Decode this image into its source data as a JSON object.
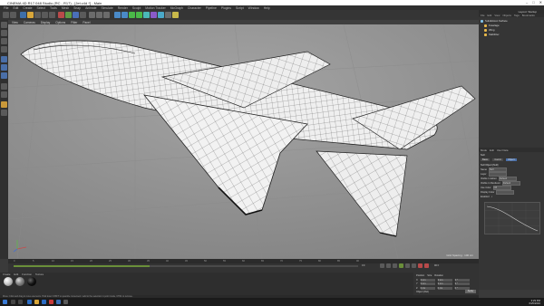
{
  "window": {
    "title": "CINEMA 4D R17.048 Studio (RC - R17) - [Jet.c4d *] - Main",
    "controls": [
      "–",
      "□",
      "✕"
    ]
  },
  "menubar": [
    "File",
    "Edit",
    "Create",
    "Select",
    "Tools",
    "Mesh",
    "Snap",
    "Animate",
    "Simulate",
    "Render",
    "Sculpt",
    "Motion Tracker",
    "MoGraph",
    "Character",
    "Pipeline",
    "Plugins",
    "Script",
    "Window",
    "Help"
  ],
  "toolbar": {
    "icons": [
      "undo-icon",
      "redo-icon",
      "live-selection-icon",
      "move-icon",
      "scale-icon",
      "rotate-icon",
      "recent-tools-icon",
      "x-axis-icon",
      "y-axis-icon",
      "z-axis-icon",
      "coordinate-system-icon",
      "render-view-icon",
      "render-picture-viewer-icon",
      "render-settings-icon",
      "cube-icon",
      "pen-icon",
      "subdivision-icon",
      "array-icon",
      "cloner-icon",
      "deformer-icon",
      "floor-icon",
      "camera-icon",
      "light-icon"
    ]
  },
  "viewport": {
    "menu": [
      "View",
      "Cameras",
      "Display",
      "Options",
      "Filter",
      "Panel"
    ],
    "info": "Grid Spacing : 100 cm"
  },
  "right_panel": {
    "layout_label": "Layout:",
    "layout_value": "Startup",
    "object_tabs": [
      "File",
      "Edit",
      "View",
      "Objects",
      "Tags",
      "Bookmarks"
    ],
    "objects": [
      {
        "name": "Subdivision Surface",
        "color": "#7fc1e8"
      },
      {
        "name": "Fuselage",
        "color": "#e8b84a"
      },
      {
        "name": "Wing",
        "color": "#e8b84a"
      },
      {
        "name": "Stabilizer",
        "color": "#e8b84a"
      }
    ],
    "attributes": {
      "tabs": [
        "Mode",
        "Edit",
        "User Data"
      ],
      "object_label": "Null",
      "subtabs": [
        "Basic",
        "Coord.",
        "Object"
      ],
      "section": "Null Object [Null]",
      "fields": [
        {
          "label": "Name",
          "value": "Null"
        },
        {
          "label": "Layer",
          "value": ""
        },
        {
          "label": "Visible in Editor",
          "value": "Default"
        },
        {
          "label": "Visible in Renderer",
          "value": "Default"
        },
        {
          "label": "Use Color",
          "value": "Off"
        },
        {
          "label": "Display Color",
          "value": ""
        },
        {
          "label": "Enabled",
          "value": "✓"
        }
      ]
    }
  },
  "timeline": {
    "frames": [
      "0",
      "5",
      "10",
      "15",
      "20",
      "25",
      "30",
      "35",
      "40",
      "45",
      "50",
      "55",
      "60",
      "65",
      "70",
      "75",
      "80",
      "85",
      "90"
    ],
    "current_frame": "0 F",
    "end_frame": "90 F"
  },
  "materials": {
    "menu": [
      "Create",
      "Edit",
      "Function",
      "Texture"
    ],
    "swatches": [
      "#cfcfcf",
      "#8a8a8a",
      "#111111"
    ]
  },
  "coordinates": {
    "headers": [
      "Position",
      "Size",
      "Rotation"
    ],
    "rows": [
      {
        "axis": "X",
        "p": "0 cm",
        "s": "0 cm",
        "r": "0 °"
      },
      {
        "axis": "Y",
        "p": "0 cm",
        "s": "0 cm",
        "r": "0 °"
      },
      {
        "axis": "Z",
        "p": "0 cm",
        "s": "0 cm",
        "r": "0 °"
      }
    ],
    "mode": "Object (Rel)",
    "apply": "Apply"
  },
  "statusbar": "Move: Click and drag to move elements. Hold down SHIFT to quantize movement / add to the selection in point mode, CTRL to remove.",
  "taskbar": {
    "time": "3:29 PM",
    "date": "6/25/2016"
  }
}
